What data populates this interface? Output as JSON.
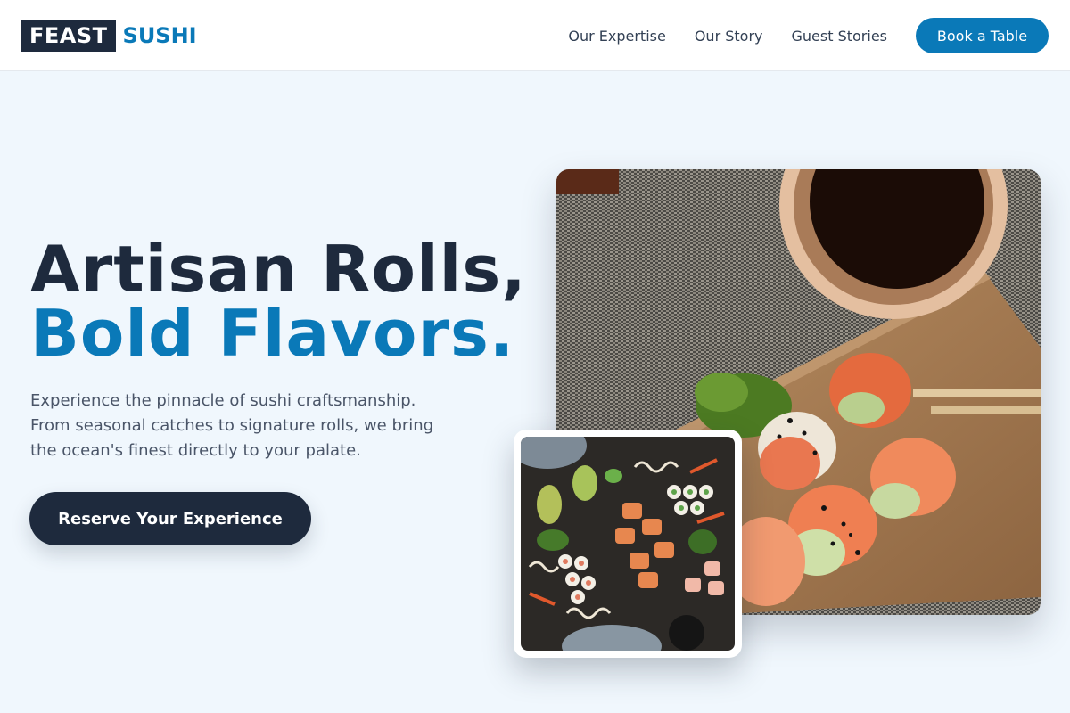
{
  "brand": {
    "name_box": "FEAST",
    "name_accent": "SUSHI"
  },
  "nav": {
    "links": [
      "Our Expertise",
      "Our Story",
      "Guest Stories"
    ],
    "cta": "Book a Table"
  },
  "hero": {
    "title_line1": "Artisan Rolls,",
    "title_line2": "Bold Flavors.",
    "description": "Experience the pinnacle of sushi craftsmanship. From seasonal catches to signature rolls, we bring the ocean's finest directly to your palate.",
    "cta": "Reserve Your Experience"
  },
  "images": {
    "main_alt": "Salmon and avocado sushi rolls on a wooden board with soy sauce bowl and chopsticks",
    "secondary_alt": "Assorted sushi rolls platter on a dark slate"
  },
  "colors": {
    "brand_dark": "#1e2a3d",
    "brand_accent": "#0a79b8",
    "page_bg": "#f0f7fd"
  }
}
